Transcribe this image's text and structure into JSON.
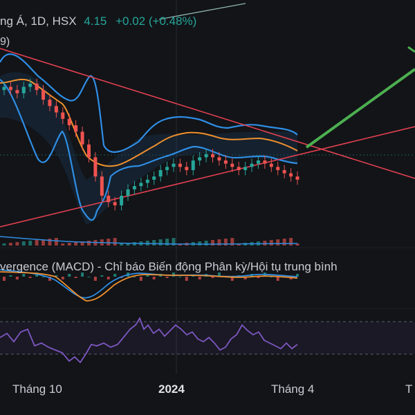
{
  "header": {
    "symbol_text": "ng Á, 1D, HSX",
    "price": "4.15",
    "change": "+0.02 (+0.48%)",
    "line2": "9)"
  },
  "macd_panel": {
    "title": "vergence (MACD) - Chỉ báo Biến động Phân kỳ/Hội tụ trung bình"
  },
  "x_axis": {
    "labels": [
      "Tháng 10",
      "2024",
      "Tháng 4",
      "T"
    ]
  },
  "colors": {
    "background": "#121418",
    "up": "#26a69a",
    "down": "#ef5350",
    "bollinger": "#2f8ee5",
    "basis": "#f0912e",
    "trendline": "#e0404f",
    "projection": "#4caf50",
    "rsi": "#7e57c2",
    "macd": "#2f8ee5",
    "signal": "#f0912e"
  },
  "chart_data": {
    "type": "candlestick",
    "indicators": [
      "Bollinger Bands",
      "Volume",
      "MACD",
      "RSI"
    ],
    "x_axis_labels": [
      "Tháng 10",
      "2024",
      "Tháng 4",
      "T"
    ],
    "series": [
      {
        "name": "Close",
        "values": [
          5.6,
          5.55,
          5.5,
          5.6,
          5.65,
          5.55,
          5.4,
          5.3,
          5.2,
          5.1,
          5.0,
          4.9,
          4.7,
          4.5,
          4.2,
          3.9,
          3.8,
          3.75,
          3.9,
          4.0,
          4.05,
          4.1,
          4.15,
          4.2,
          4.3,
          4.35,
          4.4,
          4.35,
          4.3,
          4.45,
          4.5,
          4.55,
          4.5,
          4.45,
          4.4,
          4.35,
          4.3,
          4.35,
          4.4,
          4.45,
          4.4,
          4.35,
          4.3,
          4.25,
          4.2,
          4.15
        ]
      }
    ]
  }
}
